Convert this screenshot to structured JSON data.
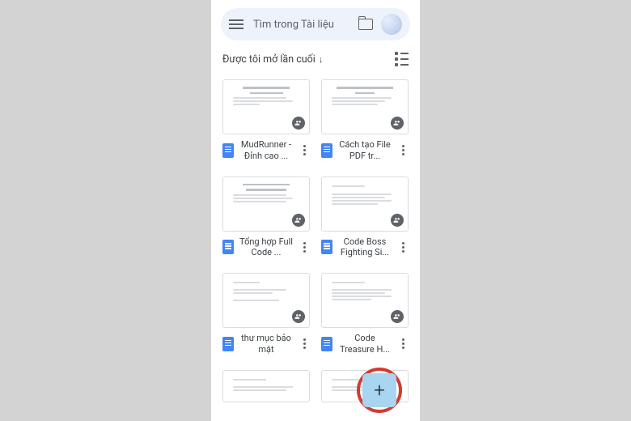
{
  "search": {
    "placeholder": "Tìm trong Tài liệu"
  },
  "sort": {
    "label": "Được tôi mở lần cuối",
    "arrow": "↓"
  },
  "docs": [
    {
      "title": "MudRunner - Đỉnh cao ..."
    },
    {
      "title": "Cách tạo File PDF tr..."
    },
    {
      "title": "Tổng hợp Full Code ..."
    },
    {
      "title": "Code Boss Fighting Si..."
    },
    {
      "title": "thư mục bảo mật"
    },
    {
      "title": "Code Treasure H..."
    }
  ],
  "fab": {
    "icon": "+"
  }
}
